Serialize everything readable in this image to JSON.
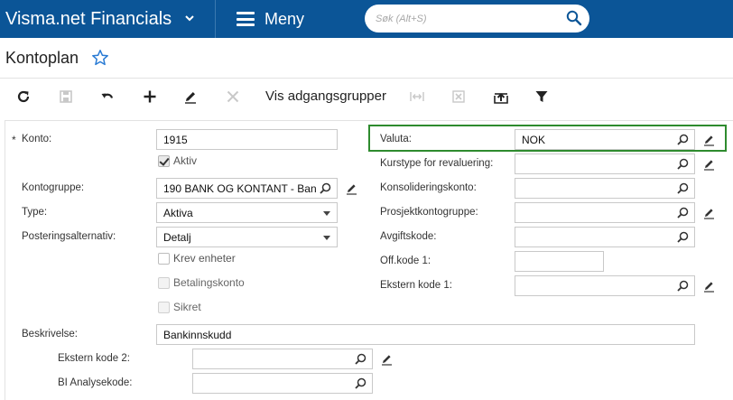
{
  "app": {
    "title": "Visma.net Financials",
    "menu_label": "Meny"
  },
  "search": {
    "placeholder": "Søk (Alt+S)"
  },
  "page": {
    "title": "Kontoplan"
  },
  "toolbar": {
    "access_groups_label": "Vis adgangsgrupper"
  },
  "form": {
    "konto": {
      "label": "Konto:",
      "required_mark": "*",
      "value": "1915"
    },
    "aktiv": {
      "label": "Aktiv",
      "checked": true
    },
    "kontogruppe": {
      "label": "Kontogruppe:",
      "value": "190 BANK OG KONTANT - Ban"
    },
    "type": {
      "label": "Type:",
      "value": "Aktiva"
    },
    "posteringsalternativ": {
      "label": "Posteringsalternativ:",
      "value": "Detalj"
    },
    "krev_enheter": {
      "label": "Krev enheter",
      "checked": false
    },
    "betalingskonto": {
      "label": "Betalingskonto",
      "checked": false
    },
    "sikret": {
      "label": "Sikret",
      "checked": false
    },
    "valuta": {
      "label": "Valuta:",
      "value": "NOK"
    },
    "kurstype": {
      "label": "Kurstype for revaluering:",
      "value": ""
    },
    "konsolideringskonto": {
      "label": "Konsolideringskonto:",
      "value": ""
    },
    "prosjektkontogruppe": {
      "label": "Prosjektkontogruppe:",
      "value": ""
    },
    "avgiftskode": {
      "label": "Avgiftskode:",
      "value": ""
    },
    "off_kode_1": {
      "label": "Off.kode 1:",
      "value": ""
    },
    "ekstern_kode_1": {
      "label": "Ekstern kode 1:",
      "value": ""
    },
    "beskrivelse": {
      "label": "Beskrivelse:",
      "value": "Bankinnskudd"
    },
    "ekstern_kode_2": {
      "label": "Ekstern kode 2:",
      "value": ""
    },
    "bi_analysekode": {
      "label": "BI Analysekode:",
      "value": ""
    }
  },
  "colors": {
    "header_bg": "#0b5597",
    "highlight_border": "#2e8b2e"
  }
}
